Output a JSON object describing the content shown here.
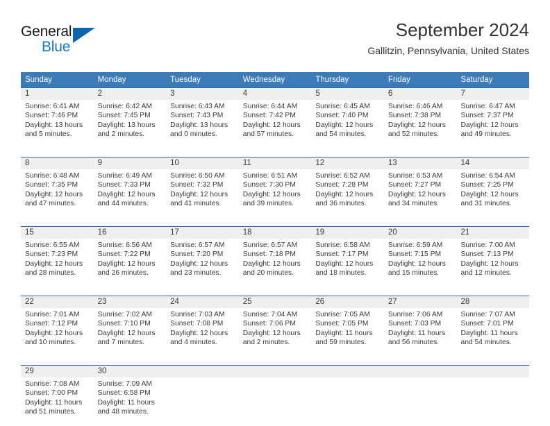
{
  "brand": {
    "name_part1": "General",
    "name_part2": "Blue",
    "logo_icon": "triangle-logo-icon"
  },
  "header": {
    "month_title": "September 2024",
    "location": "Gallitzin, Pennsylvania, United States"
  },
  "colors": {
    "header_blue": "#3b7cb8",
    "row_divider_blue": "#2a6aa8",
    "day_band_gray": "#efefef",
    "brand_blue": "#1b76c4",
    "text": "#3a3a3a"
  },
  "calendar": {
    "weekdays": [
      "Sunday",
      "Monday",
      "Tuesday",
      "Wednesday",
      "Thursday",
      "Friday",
      "Saturday"
    ],
    "weeks": [
      [
        {
          "day": "1",
          "sunrise": "Sunrise: 6:41 AM",
          "sunset": "Sunset: 7:46 PM",
          "daylight1": "Daylight: 13 hours",
          "daylight2": "and 5 minutes."
        },
        {
          "day": "2",
          "sunrise": "Sunrise: 6:42 AM",
          "sunset": "Sunset: 7:45 PM",
          "daylight1": "Daylight: 13 hours",
          "daylight2": "and 2 minutes."
        },
        {
          "day": "3",
          "sunrise": "Sunrise: 6:43 AM",
          "sunset": "Sunset: 7:43 PM",
          "daylight1": "Daylight: 13 hours",
          "daylight2": "and 0 minutes."
        },
        {
          "day": "4",
          "sunrise": "Sunrise: 6:44 AM",
          "sunset": "Sunset: 7:42 PM",
          "daylight1": "Daylight: 12 hours",
          "daylight2": "and 57 minutes."
        },
        {
          "day": "5",
          "sunrise": "Sunrise: 6:45 AM",
          "sunset": "Sunset: 7:40 PM",
          "daylight1": "Daylight: 12 hours",
          "daylight2": "and 54 minutes."
        },
        {
          "day": "6",
          "sunrise": "Sunrise: 6:46 AM",
          "sunset": "Sunset: 7:38 PM",
          "daylight1": "Daylight: 12 hours",
          "daylight2": "and 52 minutes."
        },
        {
          "day": "7",
          "sunrise": "Sunrise: 6:47 AM",
          "sunset": "Sunset: 7:37 PM",
          "daylight1": "Daylight: 12 hours",
          "daylight2": "and 49 minutes."
        }
      ],
      [
        {
          "day": "8",
          "sunrise": "Sunrise: 6:48 AM",
          "sunset": "Sunset: 7:35 PM",
          "daylight1": "Daylight: 12 hours",
          "daylight2": "and 47 minutes."
        },
        {
          "day": "9",
          "sunrise": "Sunrise: 6:49 AM",
          "sunset": "Sunset: 7:33 PM",
          "daylight1": "Daylight: 12 hours",
          "daylight2": "and 44 minutes."
        },
        {
          "day": "10",
          "sunrise": "Sunrise: 6:50 AM",
          "sunset": "Sunset: 7:32 PM",
          "daylight1": "Daylight: 12 hours",
          "daylight2": "and 41 minutes."
        },
        {
          "day": "11",
          "sunrise": "Sunrise: 6:51 AM",
          "sunset": "Sunset: 7:30 PM",
          "daylight1": "Daylight: 12 hours",
          "daylight2": "and 39 minutes."
        },
        {
          "day": "12",
          "sunrise": "Sunrise: 6:52 AM",
          "sunset": "Sunset: 7:28 PM",
          "daylight1": "Daylight: 12 hours",
          "daylight2": "and 36 minutes."
        },
        {
          "day": "13",
          "sunrise": "Sunrise: 6:53 AM",
          "sunset": "Sunset: 7:27 PM",
          "daylight1": "Daylight: 12 hours",
          "daylight2": "and 34 minutes."
        },
        {
          "day": "14",
          "sunrise": "Sunrise: 6:54 AM",
          "sunset": "Sunset: 7:25 PM",
          "daylight1": "Daylight: 12 hours",
          "daylight2": "and 31 minutes."
        }
      ],
      [
        {
          "day": "15",
          "sunrise": "Sunrise: 6:55 AM",
          "sunset": "Sunset: 7:23 PM",
          "daylight1": "Daylight: 12 hours",
          "daylight2": "and 28 minutes."
        },
        {
          "day": "16",
          "sunrise": "Sunrise: 6:56 AM",
          "sunset": "Sunset: 7:22 PM",
          "daylight1": "Daylight: 12 hours",
          "daylight2": "and 26 minutes."
        },
        {
          "day": "17",
          "sunrise": "Sunrise: 6:57 AM",
          "sunset": "Sunset: 7:20 PM",
          "daylight1": "Daylight: 12 hours",
          "daylight2": "and 23 minutes."
        },
        {
          "day": "18",
          "sunrise": "Sunrise: 6:57 AM",
          "sunset": "Sunset: 7:18 PM",
          "daylight1": "Daylight: 12 hours",
          "daylight2": "and 20 minutes."
        },
        {
          "day": "19",
          "sunrise": "Sunrise: 6:58 AM",
          "sunset": "Sunset: 7:17 PM",
          "daylight1": "Daylight: 12 hours",
          "daylight2": "and 18 minutes."
        },
        {
          "day": "20",
          "sunrise": "Sunrise: 6:59 AM",
          "sunset": "Sunset: 7:15 PM",
          "daylight1": "Daylight: 12 hours",
          "daylight2": "and 15 minutes."
        },
        {
          "day": "21",
          "sunrise": "Sunrise: 7:00 AM",
          "sunset": "Sunset: 7:13 PM",
          "daylight1": "Daylight: 12 hours",
          "daylight2": "and 12 minutes."
        }
      ],
      [
        {
          "day": "22",
          "sunrise": "Sunrise: 7:01 AM",
          "sunset": "Sunset: 7:12 PM",
          "daylight1": "Daylight: 12 hours",
          "daylight2": "and 10 minutes."
        },
        {
          "day": "23",
          "sunrise": "Sunrise: 7:02 AM",
          "sunset": "Sunset: 7:10 PM",
          "daylight1": "Daylight: 12 hours",
          "daylight2": "and 7 minutes."
        },
        {
          "day": "24",
          "sunrise": "Sunrise: 7:03 AM",
          "sunset": "Sunset: 7:08 PM",
          "daylight1": "Daylight: 12 hours",
          "daylight2": "and 4 minutes."
        },
        {
          "day": "25",
          "sunrise": "Sunrise: 7:04 AM",
          "sunset": "Sunset: 7:06 PM",
          "daylight1": "Daylight: 12 hours",
          "daylight2": "and 2 minutes."
        },
        {
          "day": "26",
          "sunrise": "Sunrise: 7:05 AM",
          "sunset": "Sunset: 7:05 PM",
          "daylight1": "Daylight: 11 hours",
          "daylight2": "and 59 minutes."
        },
        {
          "day": "27",
          "sunrise": "Sunrise: 7:06 AM",
          "sunset": "Sunset: 7:03 PM",
          "daylight1": "Daylight: 11 hours",
          "daylight2": "and 56 minutes."
        },
        {
          "day": "28",
          "sunrise": "Sunrise: 7:07 AM",
          "sunset": "Sunset: 7:01 PM",
          "daylight1": "Daylight: 11 hours",
          "daylight2": "and 54 minutes."
        }
      ],
      [
        {
          "day": "29",
          "sunrise": "Sunrise: 7:08 AM",
          "sunset": "Sunset: 7:00 PM",
          "daylight1": "Daylight: 11 hours",
          "daylight2": "and 51 minutes."
        },
        {
          "day": "30",
          "sunrise": "Sunrise: 7:09 AM",
          "sunset": "Sunset: 6:58 PM",
          "daylight1": "Daylight: 11 hours",
          "daylight2": "and 48 minutes."
        },
        {
          "day": "",
          "sunrise": "",
          "sunset": "",
          "daylight1": "",
          "daylight2": ""
        },
        {
          "day": "",
          "sunrise": "",
          "sunset": "",
          "daylight1": "",
          "daylight2": ""
        },
        {
          "day": "",
          "sunrise": "",
          "sunset": "",
          "daylight1": "",
          "daylight2": ""
        },
        {
          "day": "",
          "sunrise": "",
          "sunset": "",
          "daylight1": "",
          "daylight2": ""
        },
        {
          "day": "",
          "sunrise": "",
          "sunset": "",
          "daylight1": "",
          "daylight2": ""
        }
      ]
    ]
  }
}
